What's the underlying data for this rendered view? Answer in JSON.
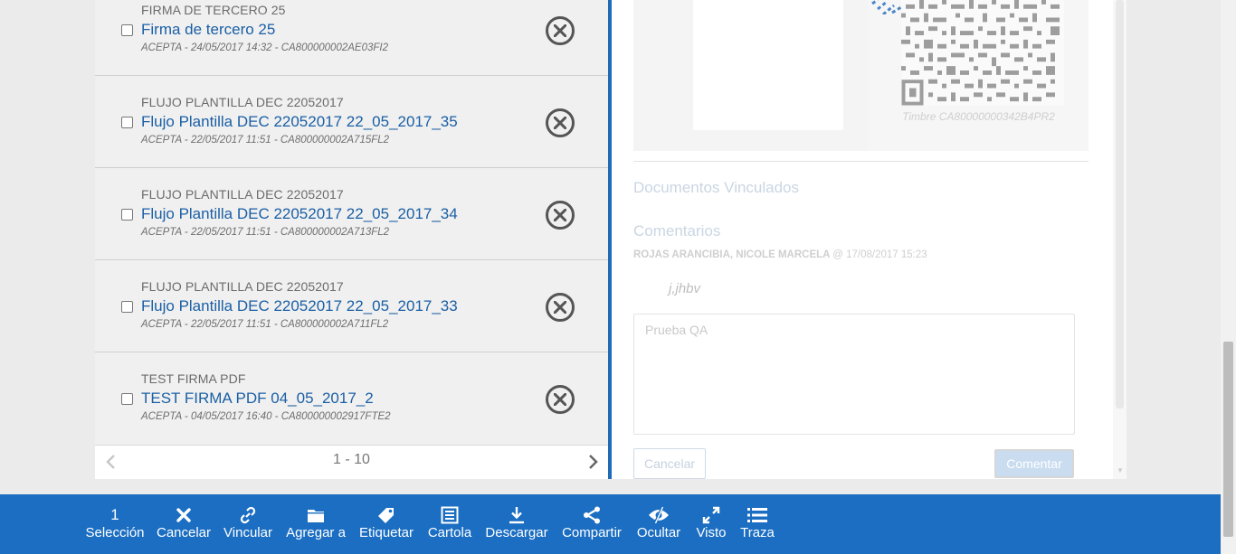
{
  "list": {
    "items": [
      {
        "category": "FIRMA DE TERCERO 25",
        "title": "Firma de tercero 25",
        "meta": "ACEPTA - 24/05/2017 14:32 - CA800000002AE03FI2"
      },
      {
        "category": "FLUJO PLANTILLA DEC 22052017",
        "title": "Flujo Plantilla DEC 22052017 22_05_2017_35",
        "meta": "ACEPTA - 22/05/2017 11:51 - CA800000002A715FL2"
      },
      {
        "category": "FLUJO PLANTILLA DEC 22052017",
        "title": "Flujo Plantilla DEC 22052017 22_05_2017_34",
        "meta": "ACEPTA - 22/05/2017 11:51 - CA800000002A713FL2"
      },
      {
        "category": "FLUJO PLANTILLA DEC 22052017",
        "title": "Flujo Plantilla DEC 22052017 22_05_2017_33",
        "meta": "ACEPTA - 22/05/2017 11:51 - CA800000002A711FL2"
      },
      {
        "category": "TEST FIRMA PDF",
        "title": "TEST FIRMA PDF 04_05_2017_2",
        "meta": "ACEPTA - 04/05/2017 16:40 - CA800000002917FTE2"
      }
    ],
    "pager": {
      "range": "1 - 10"
    }
  },
  "detail": {
    "timbre": "Timbre CA80000000342B4PR2",
    "linked_docs_title": "Documentos Vinculados",
    "comments_title": "Comentarios",
    "comment": {
      "author": "ROJAS ARANCIBIA, NICOLE MARCELA",
      "at": "@",
      "date": "17/08/2017 15:23",
      "text": "j,jhbv"
    },
    "input": {
      "value": "Prueba QA"
    },
    "cancel_label": "Cancelar",
    "comment_label": "Comentar"
  },
  "toolbar": {
    "selection_count": "1",
    "items": [
      {
        "label": "Selección",
        "icon": "count"
      },
      {
        "label": "Cancelar",
        "icon": "x-icon"
      },
      {
        "label": "Vincular",
        "icon": "link-icon"
      },
      {
        "label": "Agregar a",
        "icon": "folder-icon"
      },
      {
        "label": "Etiquetar",
        "icon": "tag-icon"
      },
      {
        "label": "Cartola",
        "icon": "list-sheet-icon"
      },
      {
        "label": "Descargar",
        "icon": "download-icon"
      },
      {
        "label": "Compartir",
        "icon": "share-icon"
      },
      {
        "label": "Ocultar",
        "icon": "eye-slash-icon"
      },
      {
        "label": "Visto",
        "icon": "expand-icon"
      },
      {
        "label": "Traza",
        "icon": "list-icon"
      }
    ]
  },
  "colors": {
    "accent": "#1b6ec2",
    "link": "#1a5fa5"
  }
}
